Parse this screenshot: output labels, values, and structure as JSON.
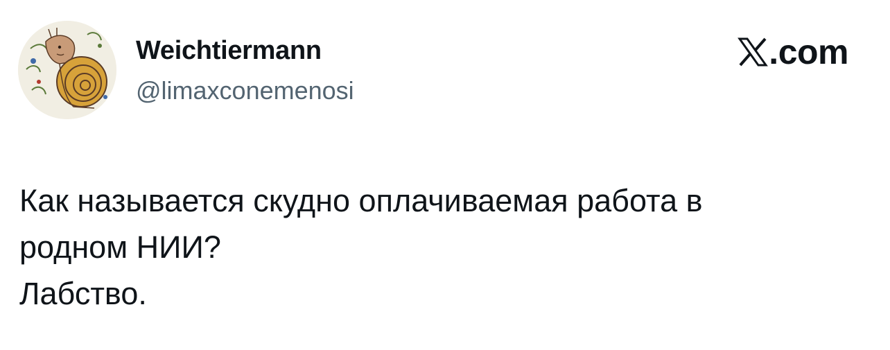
{
  "author": {
    "display_name": "Weichtiermann",
    "handle": "@limaxconemenosi",
    "avatar_icon": "snail-illustration-icon"
  },
  "brand": {
    "icon": "x-logo-icon",
    "domain": ".com"
  },
  "tweet": {
    "lines": [
      "Как называется скудно оплачиваемая работа в",
      "родном НИИ?",
      "Лабство."
    ]
  },
  "colors": {
    "text": "#0f1419",
    "secondary_text": "#536471",
    "background": "#ffffff"
  }
}
